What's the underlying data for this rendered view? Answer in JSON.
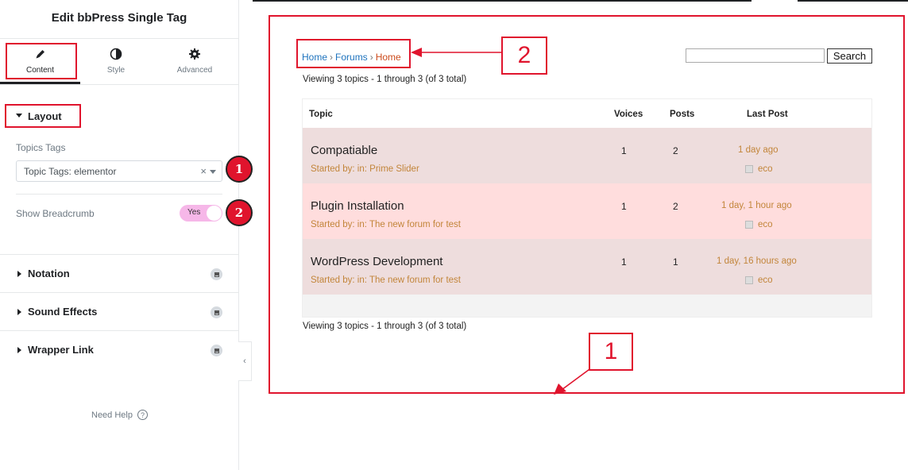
{
  "sidebar": {
    "title": "Edit bbPress Single Tag",
    "tabs": [
      {
        "label": "Content",
        "icon": "pencil-icon"
      },
      {
        "label": "Style",
        "icon": "contrast-icon"
      },
      {
        "label": "Advanced",
        "icon": "gear-icon"
      }
    ],
    "layout_section": "Layout",
    "topics_tags_label": "Topics Tags",
    "topics_tags_value": "Topic Tags: elementor",
    "show_breadcrumb_label": "Show Breadcrumb",
    "show_breadcrumb_toggle": "Yes",
    "badges": [
      "1",
      "2"
    ],
    "sections": [
      "Notation",
      "Sound Effects",
      "Wrapper Link"
    ],
    "need_help": "Need Help"
  },
  "preview": {
    "breadcrumb": [
      "Home",
      "Forums",
      "Home"
    ],
    "search_button": "Search",
    "viewing_text": "Viewing 3 topics - 1 through 3 (of 3 total)",
    "callouts": [
      "2",
      "1"
    ],
    "columns": {
      "topic": "Topic",
      "voices": "Voices",
      "posts": "Posts",
      "last_post": "Last Post"
    },
    "topics": [
      {
        "title": "Compatiable",
        "meta": "Started by: in: Prime Slider",
        "voices": "1",
        "posts": "2",
        "last_post": "1 day ago",
        "author": "eco"
      },
      {
        "title": "Plugin Installation",
        "meta": "Started by: in: The new forum for test",
        "voices": "1",
        "posts": "2",
        "last_post": "1 day, 1 hour ago",
        "author": "eco"
      },
      {
        "title": "WordPress Development",
        "meta": "Started by: in: The new forum for test",
        "voices": "1",
        "posts": "1",
        "last_post": "1 day, 16 hours ago",
        "author": "eco"
      }
    ]
  },
  "colors": {
    "annotation_red": "#e0142d",
    "row_bg_1": "#eedddd",
    "row_bg_2": "#ffdddd",
    "toggle_pink": "#f6b7e8",
    "link_blue": "#1e73be",
    "meta_orange": "#c2853a"
  }
}
